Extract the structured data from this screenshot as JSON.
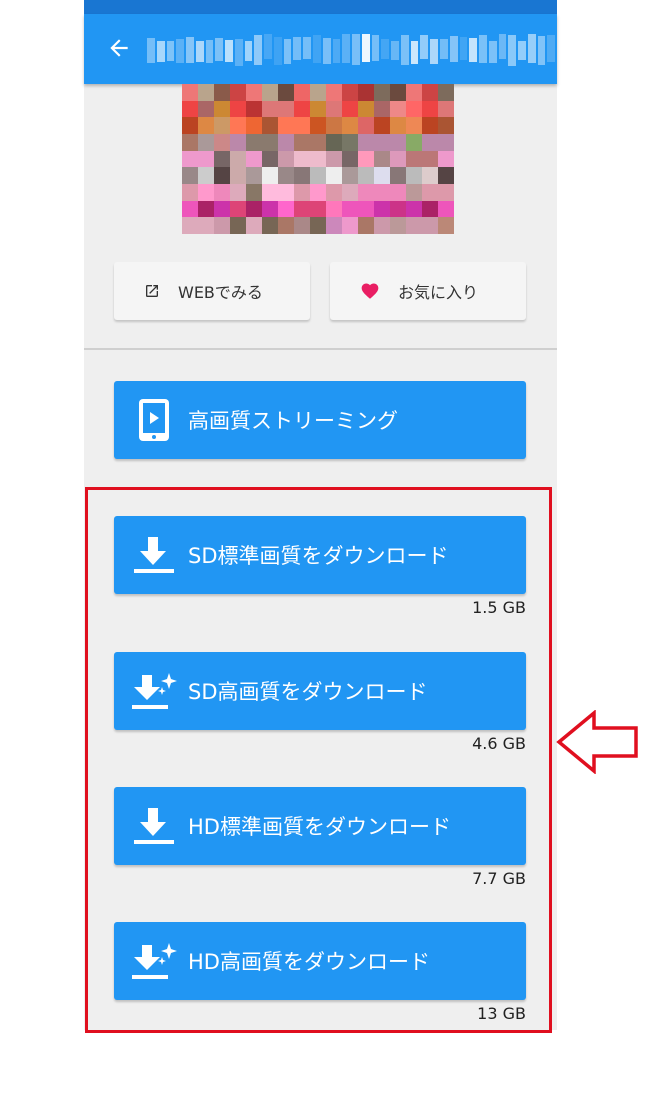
{
  "colors": {
    "appbar": "#2196f3",
    "status_bar": "#1976d2",
    "button_blue": "#2196f3",
    "favorite_heart": "#e91e63",
    "highlight_border": "#e00f1f"
  },
  "appbar": {
    "back_icon": "arrow-left-icon"
  },
  "actions": {
    "web_label": "WEBでみる",
    "web_icon": "open-in-new-icon",
    "favorite_label": "お気に入り",
    "favorite_icon": "heart-icon"
  },
  "streaming": {
    "label": "高画質ストリーミング",
    "icon": "tablet-play-icon"
  },
  "downloads": [
    {
      "label": "SD標準画質をダウンロード",
      "size": "1.5 GB",
      "icon": "download-icon"
    },
    {
      "label": "SD高画質をダウンロード",
      "size": "4.6 GB",
      "icon": "download-sparkle-icon"
    },
    {
      "label": "HD標準画質をダウンロード",
      "size": "7.7 GB",
      "icon": "download-icon"
    },
    {
      "label": "HD高画質をダウンロード",
      "size": "13 GB",
      "icon": "download-sparkle-icon"
    }
  ]
}
